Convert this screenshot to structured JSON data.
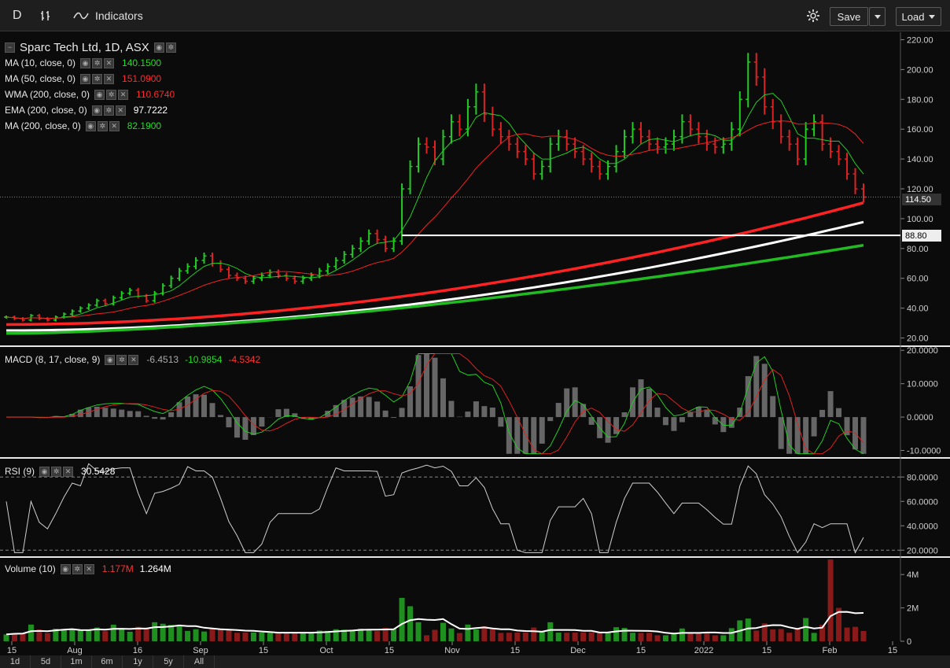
{
  "toolbar": {
    "interval": "D",
    "indicators_label": "Indicators",
    "save_label": "Save",
    "load_label": "Load"
  },
  "legend": {
    "title": "Sparc Tech Ltd, 1D, ASX",
    "studies": [
      {
        "label": "MA (10, close, 0)",
        "value": "140.1500",
        "color": "#22dd22"
      },
      {
        "label": "MA (50, close, 0)",
        "value": "151.0900",
        "color": "#ff2a2a"
      },
      {
        "label": "WMA (200, close, 0)",
        "value": "110.6740",
        "color": "#ff2a2a"
      },
      {
        "label": "EMA (200, close, 0)",
        "value": "97.7222",
        "color": "#ffffff"
      },
      {
        "label": "MA (200, close, 0)",
        "value": "82.1900",
        "color": "#22dd22"
      }
    ]
  },
  "price_tags": {
    "last": "114.50",
    "line": "88.80"
  },
  "macd": {
    "label": "MACD (8, 17, close, 9)",
    "hist": "-6.4513",
    "macd": "-10.9854",
    "signal": "-4.5342"
  },
  "rsi": {
    "label": "RSI (9)",
    "value": "30.5428"
  },
  "volume": {
    "label": "Volume (10)",
    "value": "1.177M",
    "ma": "1.264M"
  },
  "ranges": [
    "1d",
    "5d",
    "1m",
    "6m",
    "1y",
    "5y",
    "All"
  ],
  "colors": {
    "up": "#22cc22",
    "down": "#dd2222",
    "background": "#0b0b0b"
  },
  "chart_data": [
    {
      "type": "candlestick",
      "title": "Sparc Tech Ltd, 1D, ASX",
      "x": [
        "Jul 15",
        "Aug",
        "Aug 16",
        "Sep",
        "Sep 15",
        "Oct",
        "Oct 15",
        "Nov",
        "Nov 15",
        "Dec",
        "Dec 15",
        "2022",
        "Jan 15",
        "Feb",
        "Feb 15"
      ],
      "yticks": [
        "20.00",
        "40.00",
        "60.00",
        "80.00",
        "100.00",
        "120.00",
        "140.00",
        "160.00",
        "180.00",
        "200.00",
        "220.00"
      ],
      "ylim": [
        15,
        225
      ],
      "close": [
        34,
        33,
        32,
        35,
        33,
        32,
        34,
        36,
        38,
        40,
        42,
        45,
        43,
        47,
        50,
        52,
        48,
        45,
        50,
        55,
        60,
        65,
        68,
        72,
        75,
        70,
        66,
        62,
        60,
        58,
        60,
        62,
        64,
        62,
        60,
        58,
        60,
        62,
        65,
        68,
        72,
        76,
        80,
        85,
        90,
        86,
        80,
        85,
        120,
        135,
        150,
        148,
        140,
        155,
        165,
        160,
        175,
        185,
        170,
        160,
        155,
        150,
        145,
        140,
        130,
        135,
        150,
        155,
        150,
        145,
        140,
        135,
        130,
        135,
        145,
        155,
        160,
        155,
        150,
        148,
        150,
        155,
        165,
        160,
        155,
        150,
        148,
        150,
        160,
        180,
        205,
        195,
        175,
        165,
        155,
        150,
        140,
        160,
        165,
        150,
        145,
        140,
        130,
        120,
        114.5
      ],
      "series": [
        {
          "name": "MA (10, close, 0)",
          "last": 140.15
        },
        {
          "name": "MA (50, close, 0)",
          "last": 151.09
        },
        {
          "name": "WMA (200, close, 0)",
          "last": 110.674
        },
        {
          "name": "EMA (200, close, 0)",
          "last": 97.7222
        },
        {
          "name": "MA (200, close, 0)",
          "last": 82.19
        }
      ],
      "horizontal_line": 88.8
    },
    {
      "type": "line",
      "title": "MACD (8, 17, close, 9)",
      "yticks": [
        "-10.0000",
        "0.0000",
        "10.0000",
        "20.0000"
      ],
      "ylim": [
        -12,
        21
      ]
    },
    {
      "type": "line",
      "title": "RSI (9)",
      "yticks": [
        "20.0000",
        "40.0000",
        "60.0000",
        "80.0000"
      ],
      "ylim": [
        15,
        95
      ],
      "levels": [
        80,
        20
      ]
    },
    {
      "type": "bar",
      "title": "Volume (10)",
      "yticks": [
        "0",
        "2M",
        "4M"
      ],
      "ylim": [
        0,
        5
      ]
    }
  ]
}
